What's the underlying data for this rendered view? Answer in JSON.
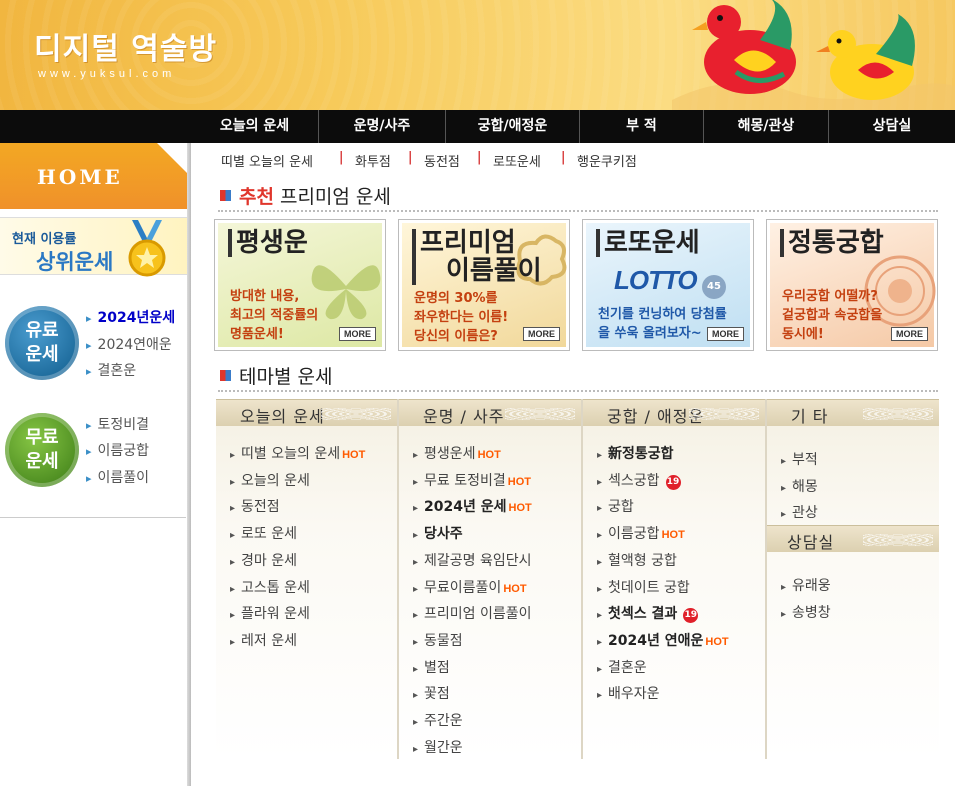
{
  "header": {
    "logo_title": "디지털 역술방",
    "logo_url": "www.yuksul.com"
  },
  "nav": [
    "오늘의 운세",
    "운명/사주",
    "궁합/애정운",
    "부 적",
    "해몽/관상",
    "상담실"
  ],
  "sidebar": {
    "home_label": "HOME",
    "rank_line1": "현재 이용률",
    "rank_line2": "상위운세",
    "paid_badge": [
      "유료",
      "운세"
    ],
    "paid_links": [
      "2024년운세",
      "2024연애운",
      "결혼운"
    ],
    "free_badge": [
      "무료",
      "운세"
    ],
    "free_links": [
      "토정비결",
      "이름궁합",
      "이름풀이"
    ]
  },
  "subnav": [
    "띠별 오늘의 운세",
    "화투점",
    "동전점",
    "로또운세",
    "행운쿠키점"
  ],
  "premium": {
    "title_highlight": "추천",
    "title_rest": "프리미엄 운세",
    "cards": [
      {
        "title": "평생운",
        "desc": [
          "방대한 내용,",
          "최고의 적중률의",
          "명품운세!"
        ],
        "more": "MORE"
      },
      {
        "title": "프리미엄",
        "title2": "이름풀이",
        "desc": [
          "운명의 30%를",
          "좌우한다는 이름!",
          "당신의 이름은?"
        ],
        "more": "MORE"
      },
      {
        "title": "로또운세",
        "logo": "LOTTO",
        "logo_num": "45",
        "desc": [
          "천기를 컨닝하여 당첨률",
          "을 쑤욱 올려보자~"
        ],
        "more": "MORE"
      },
      {
        "title": "정통궁합",
        "desc": [
          "우리궁합 어떨까?",
          "겉궁합과 속궁합을",
          "동시에!"
        ],
        "more": "MORE"
      }
    ]
  },
  "theme": {
    "title": "테마별 운세",
    "hot_label": "HOT",
    "badge_19": "19",
    "columns": [
      {
        "head": "오늘의 운세",
        "items": [
          {
            "label": "띠별 오늘의 운세",
            "hot": true
          },
          {
            "label": "오늘의 운세"
          },
          {
            "label": "동전점"
          },
          {
            "label": "로또 운세"
          },
          {
            "label": "경마 운세"
          },
          {
            "label": "고스톱 운세"
          },
          {
            "label": "플라워 운세"
          },
          {
            "label": "레저 운세"
          }
        ]
      },
      {
        "head": "운명 / 사주",
        "items": [
          {
            "label": "평생운세",
            "hot": true
          },
          {
            "label": "무료 토정비결",
            "hot": true
          },
          {
            "label": "2024년 운세",
            "hot": true,
            "bold": true
          },
          {
            "label": "당사주",
            "bold": true
          },
          {
            "label": "제갈공명 육임단시"
          },
          {
            "label": "무료이름풀이",
            "hot": true
          },
          {
            "label": "프리미엄 이름풀이"
          },
          {
            "label": "동물점"
          },
          {
            "label": "별점"
          },
          {
            "label": "꽃점"
          },
          {
            "label": "주간운"
          },
          {
            "label": "월간운"
          }
        ]
      },
      {
        "head": "궁합 / 애정운",
        "items": [
          {
            "label": "新정통궁합",
            "bold": true
          },
          {
            "label": "섹스궁합",
            "b19": true
          },
          {
            "label": "궁합"
          },
          {
            "label": "이름궁합",
            "hot": true
          },
          {
            "label": "혈액형 궁합"
          },
          {
            "label": "첫데이트 궁합"
          },
          {
            "label": "첫섹스 결과",
            "b19": true,
            "bold": true
          },
          {
            "label": "2024년 연애운",
            "hot": true,
            "bold": true
          },
          {
            "label": "결혼운"
          },
          {
            "label": "배우자운"
          }
        ]
      },
      {
        "head": "기 타",
        "items": [
          {
            "label": "부적"
          },
          {
            "label": "해몽"
          },
          {
            "label": "관상"
          }
        ],
        "head2": "상담실",
        "items2": [
          {
            "label": "유래웅"
          },
          {
            "label": "송병창"
          }
        ]
      }
    ]
  },
  "colors": {
    "header_orange": "#f5c24e",
    "nav_black": "#0c0c0c",
    "hot_orange": "#ff5a00",
    "accent_red": "#e0362c",
    "link_blue": "#0000c8"
  }
}
